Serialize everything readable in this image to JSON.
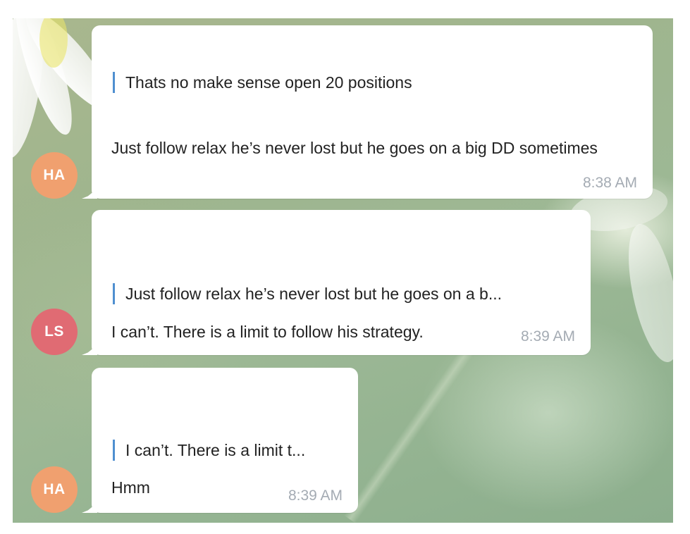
{
  "messages": [
    {
      "avatar_initials": "HA",
      "avatar_color": "#f0a06f",
      "quoted_text": "Thats no make sense open 20 positions",
      "text": "Just follow relax he’s never lost but he goes on a big DD sometimes",
      "time": "8:38 AM"
    },
    {
      "avatar_initials": "LS",
      "avatar_color": "#e06b73",
      "quoted_text": "Just follow relax he’s never lost but he goes on a b...",
      "text": "I can’t. There is a limit to follow his strategy.",
      "time": "8:39 AM"
    },
    {
      "avatar_initials": "HA",
      "avatar_color": "#f0a06f",
      "quoted_text": "I can’t. There is a limit t...",
      "text": "Hmm",
      "time": "8:39 AM"
    }
  ],
  "colors": {
    "quote_bar": "#4f8fd0",
    "timestamp": "#a4abb3",
    "bubble": "#ffffff"
  }
}
